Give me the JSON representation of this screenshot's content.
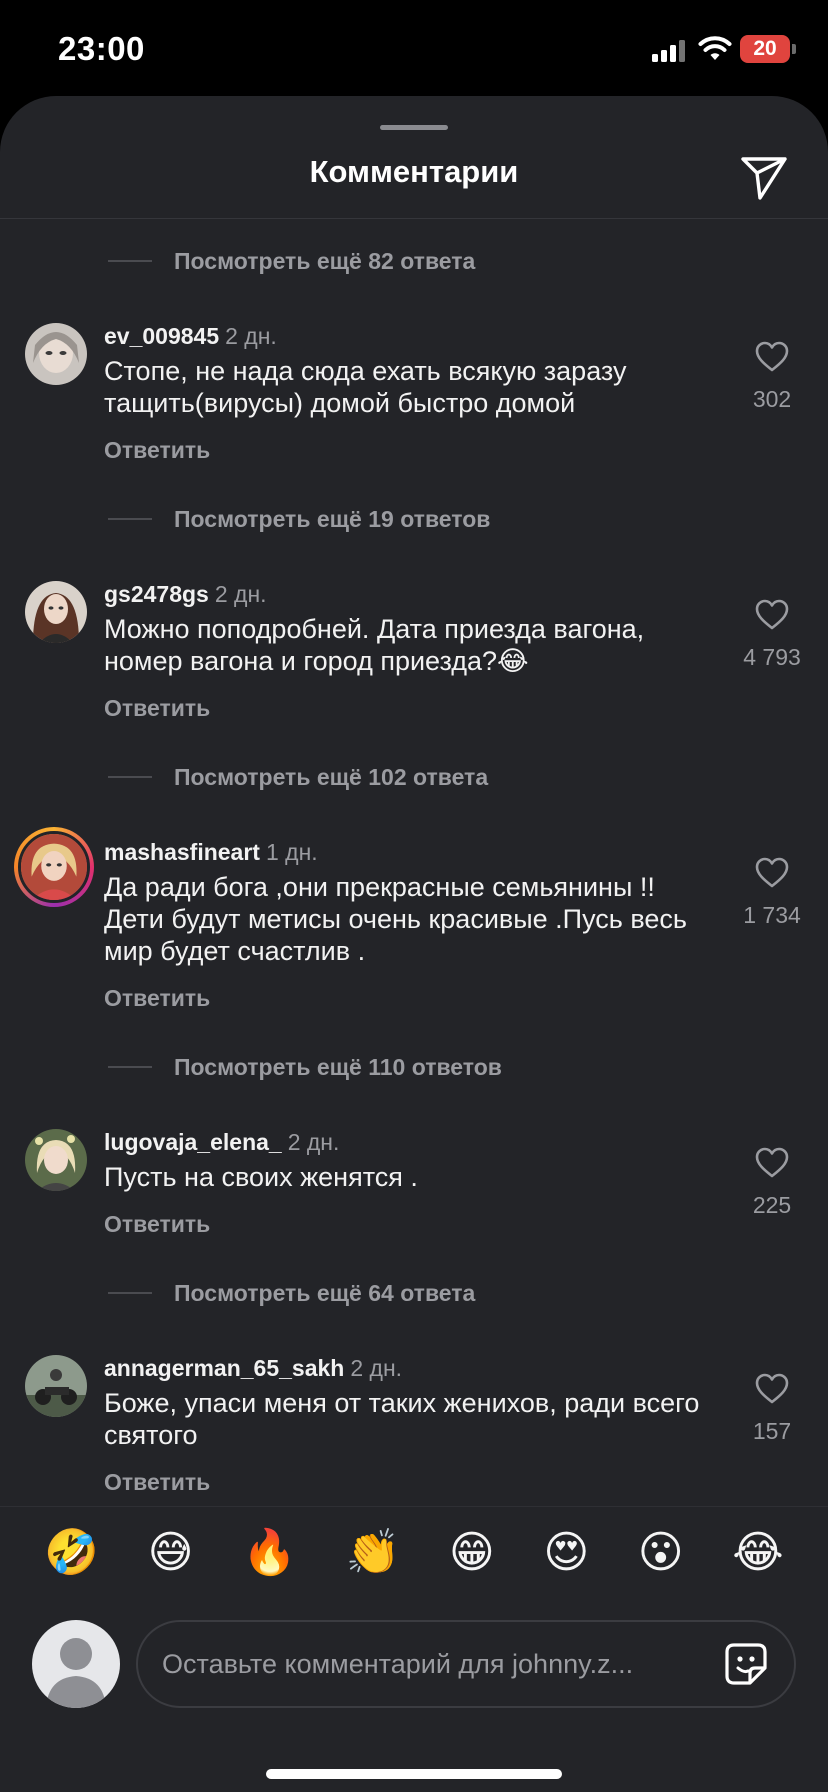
{
  "status_bar": {
    "time": "23:00",
    "battery": "20"
  },
  "sheet": {
    "title": "Комментарии"
  },
  "more_replies": [
    {
      "text": "Посмотреть ещё 82 ответа"
    },
    {
      "text": "Посмотреть ещё 19 ответов"
    },
    {
      "text": "Посмотреть ещё 102 ответа"
    },
    {
      "text": "Посмотреть ещё 110 ответов"
    },
    {
      "text": "Посмотреть ещё 64 ответа"
    }
  ],
  "comments": [
    {
      "username": "ev_009845",
      "time": "2 дн.",
      "text": "Стопе, не нада сюда ехать всякую заразу тащить(вирусы) домой быстро домой",
      "reply": "Ответить",
      "likes": "302"
    },
    {
      "username": "gs2478gs",
      "time": "2 дн.",
      "text": "Можно поподробней. Дата приезда вагона, номер вагона и город приезда?😂",
      "reply": "Ответить",
      "likes": "4 793"
    },
    {
      "username": "mashasfineart",
      "time": "1 дн.",
      "text": "Да ради бога ,они прекрасные семьянины !! Дети будут метисы очень красивые .Пусь весь мир будет счастлив .",
      "reply": "Ответить",
      "likes": "1 734"
    },
    {
      "username": "lugovaja_elena_",
      "time": "2 дн.",
      "text": "Пусть на своих женятся .",
      "reply": "Ответить",
      "likes": "225"
    },
    {
      "username": "annagerman_65_sakh",
      "time": "2 дн.",
      "text": "Боже, упаси меня от таких женихов, ради всего святого",
      "reply": "Ответить",
      "likes": "157"
    }
  ],
  "emoji_bar": [
    "🤣",
    "😅",
    "🔥",
    "👏",
    "😁",
    "😍",
    "😮",
    "😂"
  ],
  "composer": {
    "placeholder": "Оставьте комментарий для johnny.z..."
  },
  "icons": {
    "send": "paper-plane-icon",
    "like": "heart-outline-icon",
    "sticker": "sticker-icon",
    "avatar": "default-avatar-icon"
  },
  "colors": {
    "background": "#232428",
    "text": "#f2f2f2",
    "muted": "#9b9ca1",
    "battery": "#e0443e"
  }
}
